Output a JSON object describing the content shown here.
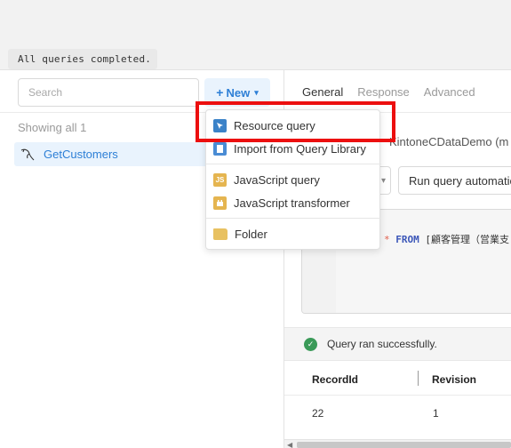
{
  "toast": "All queries completed.",
  "left_panel": {
    "search_placeholder": "Search",
    "new_button": {
      "plus": "+",
      "label": "New",
      "chevron": "▾"
    },
    "showing": "Showing all 1",
    "queries": [
      {
        "label": "GetCustomers",
        "icon": "mysql-dolphin-icon"
      }
    ]
  },
  "right_panel": {
    "tabs": [
      "General",
      "Response",
      "Advanced"
    ],
    "resource": "KintoneCDataDemo (m",
    "run_mode": "Run query automatic",
    "code": {
      "op": "*",
      "kw": "FROM",
      "rest": "[顧客管理（営業支"
    },
    "status": "Query ran successfully.",
    "table": {
      "headers": [
        "RecordId",
        "Revision"
      ],
      "rows": [
        [
          "22",
          "1"
        ]
      ]
    }
  },
  "new_menu": {
    "items": [
      {
        "label": "Resource query",
        "icon": "resource-query-icon"
      },
      {
        "label": "Import from Query Library",
        "icon": "query-library-icon"
      },
      {
        "label": "JavaScript query",
        "icon": "javascript-icon",
        "badge": "JS"
      },
      {
        "label": "JavaScript transformer",
        "icon": "transformer-icon"
      },
      {
        "label": "Folder",
        "icon": "folder-icon"
      }
    ]
  },
  "colors": {
    "accent": "#2d7fd6",
    "highlight": "#ec0f0f",
    "success": "#3a9a58"
  }
}
